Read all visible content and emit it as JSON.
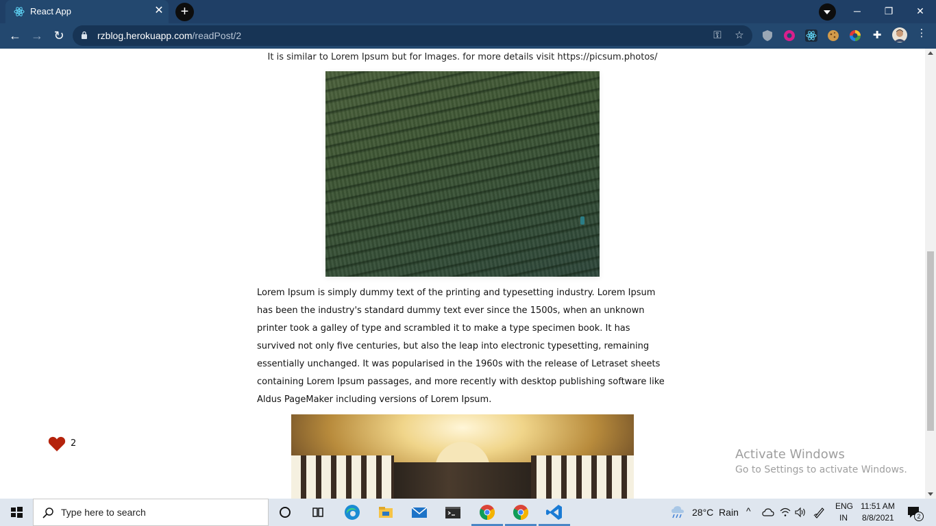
{
  "browser": {
    "tab_title": "React App",
    "url_host": "rzblog.herokuapp.com",
    "url_path": "/readPost/2"
  },
  "post": {
    "image_caption": "It is similar to Lorem Ipsum but for Images. for more details visit https://picsum.photos/",
    "paragraph": "Lorem Ipsum is simply dummy text of the printing and typesetting industry. Lorem Ipsum has been the industry's standard dummy text ever since the 1500s, when an unknown printer took a galley of type and scrambled it to make a type specimen book. It has survived not only five centuries, but also the leap into electronic typesetting, remaining essentially unchanged. It was popularised in the 1960s with the release of Letraset sheets containing Lorem Ipsum passages, and more recently with desktop publishing software like Aldus PageMaker including versions of Lorem Ipsum.",
    "like_count": "2"
  },
  "watermark": {
    "line1": "Activate Windows",
    "line2": "Go to Settings to activate Windows."
  },
  "taskbar": {
    "search_placeholder": "Type here to search",
    "weather": "28°C  Rain",
    "lang_line1": "ENG",
    "lang_line2": "IN",
    "time": "11:51 AM",
    "date": "8/8/2021",
    "notification_count": "2"
  },
  "colors": {
    "chrome_bg": "#1f3f66",
    "heart": "#b5230c"
  }
}
